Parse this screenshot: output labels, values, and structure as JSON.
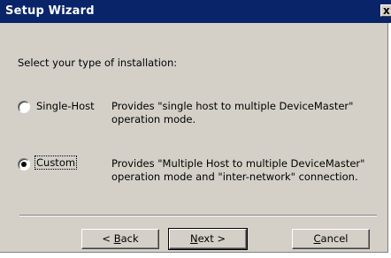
{
  "window": {
    "title": "Setup Wizard",
    "close_glyph": "x"
  },
  "prompt": "Select your type of installation:",
  "options": [
    {
      "label": "Single-Host",
      "selected": false,
      "desc_line1": "Provides \"single host to multiple DeviceMaster\"",
      "desc_line2": "operation mode."
    },
    {
      "label": "Custom",
      "selected": true,
      "desc_line1": "Provides \"Multiple Host to multiple DeviceMaster\"",
      "desc_line2": "operation mode and \"inter-network\" connection."
    }
  ],
  "buttons": {
    "back": {
      "prefix": "< ",
      "mnemonic": "B",
      "rest": "ack"
    },
    "next": {
      "mnemonic": "N",
      "rest": "ext >"
    },
    "cancel": {
      "mnemonic": "C",
      "rest": "ancel"
    }
  }
}
